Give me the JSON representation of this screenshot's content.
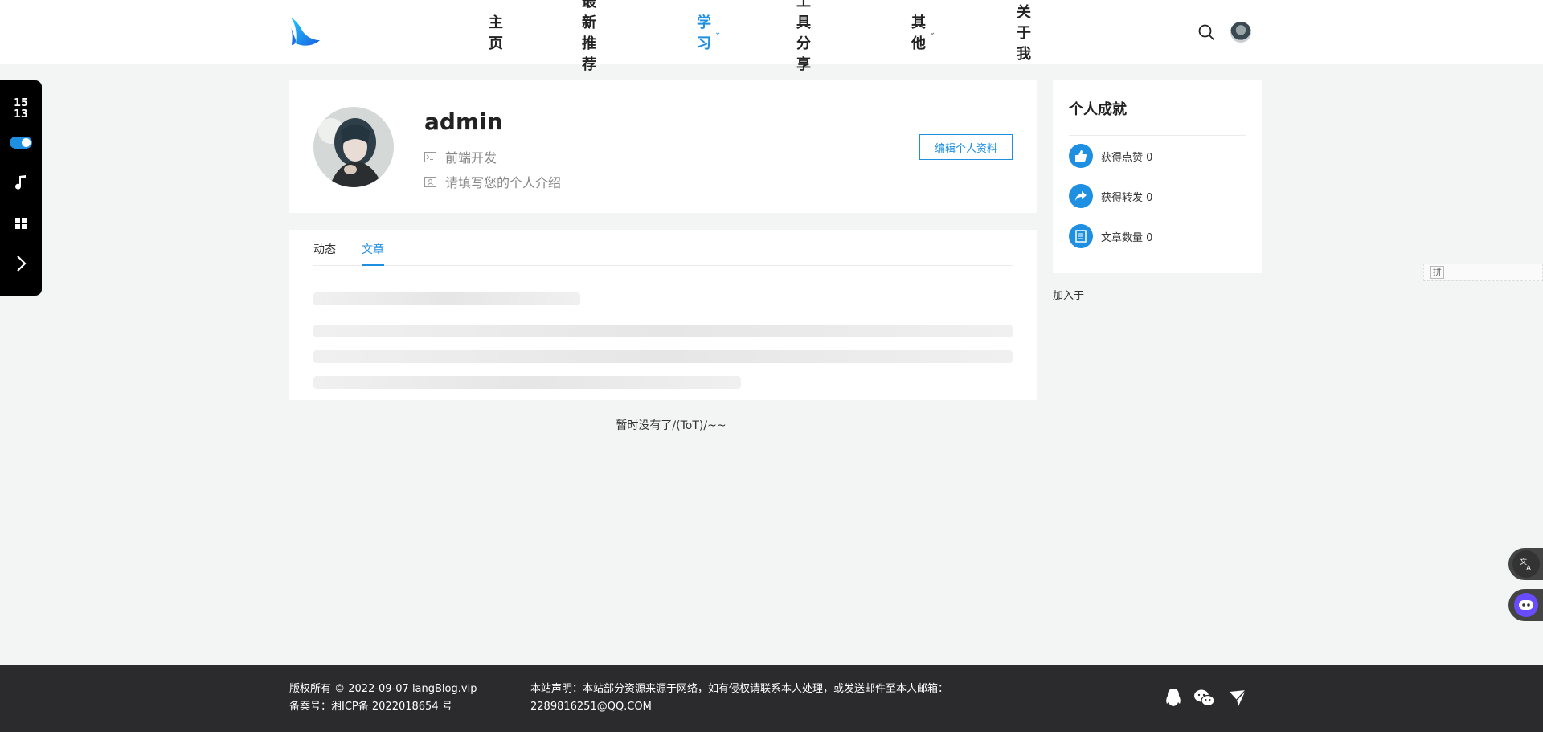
{
  "nav": {
    "items": [
      {
        "label": "主页",
        "dropdown": false,
        "active": false
      },
      {
        "label": "最新推荐",
        "dropdown": false,
        "active": false
      },
      {
        "label": "学习",
        "dropdown": true,
        "active": true
      },
      {
        "label": "工具分享",
        "dropdown": false,
        "active": false
      },
      {
        "label": "其他",
        "dropdown": true,
        "active": false
      },
      {
        "label": "关于我",
        "dropdown": false,
        "active": false
      }
    ],
    "chevron": "⌄"
  },
  "dock": {
    "hour": "15",
    "minute": "13",
    "icons": [
      "theme-toggle",
      "music-note-icon",
      "grid-apps-icon",
      "chevron-right-icon"
    ]
  },
  "profile": {
    "username": "admin",
    "role": "前端开发",
    "bio_placeholder": "请填写您的个人介绍",
    "edit_button": "编辑个人资料"
  },
  "tabs": [
    {
      "label": "动态",
      "active": false
    },
    {
      "label": "文章",
      "active": true
    }
  ],
  "empty_message": "暂时没有了/(ToT)/~~",
  "achievements": {
    "title": "个人成就",
    "items": [
      {
        "label": "获得点赞 0",
        "icon": "thumbs-up-icon"
      },
      {
        "label": "获得转发 0",
        "icon": "share-icon"
      },
      {
        "label": "文章数量 0",
        "icon": "document-icon"
      }
    ],
    "joined_label": "加入于"
  },
  "ime": {
    "label": "拼"
  },
  "footer": {
    "copyright": "版权所有 © 2022-09-07 langBlog.vip",
    "icp": "备案号：湘ICP备 2022018654 号",
    "notice": "本站声明：本站部分资源来源于网络，如有侵权请联系本人处理，或发送邮件至本人邮箱：",
    "email": "2289816251@QQ.COM",
    "icons": [
      "qq-icon",
      "wechat-icon",
      "send-icon"
    ]
  },
  "colors": {
    "accent": "#1e8fe1",
    "footer_bg": "#2b2b2e",
    "page_bg": "#f3f4f4"
  }
}
